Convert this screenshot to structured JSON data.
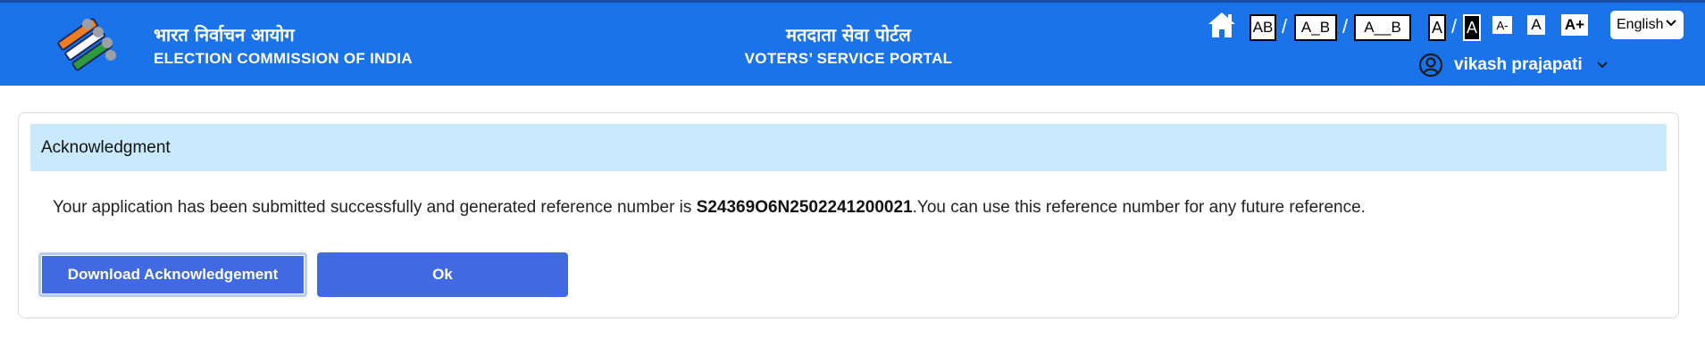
{
  "header": {
    "brand_hindi": "भारत निर्वाचन आयोग",
    "brand_english": "ELECTION COMMISSION OF INDIA",
    "portal_hindi": "मतदाता सेवा पोर्टल",
    "portal_english": "VOTERS’ SERVICE PORTAL",
    "home_icon": "home-icon",
    "spacing_options": [
      "AB",
      "A_B",
      "A__B"
    ],
    "font_contrast": [
      "A",
      "A"
    ],
    "font_sizes": [
      "A-",
      "A",
      "A+"
    ],
    "language": "English",
    "user_name": "vikash prajapati",
    "accent_color": "#1a73e8"
  },
  "acknowledgment": {
    "title": "Acknowledgment",
    "message_prefix": "Your application has been submitted successfully and generated reference number is ",
    "reference_number": "S24369O6N2502241200021",
    "message_suffix": ".You can use this reference number for any future reference.",
    "download_label": "Download Acknowledgement",
    "ok_label": "Ok",
    "header_bg": "#c9e9fc",
    "button_color": "#4169e1"
  }
}
